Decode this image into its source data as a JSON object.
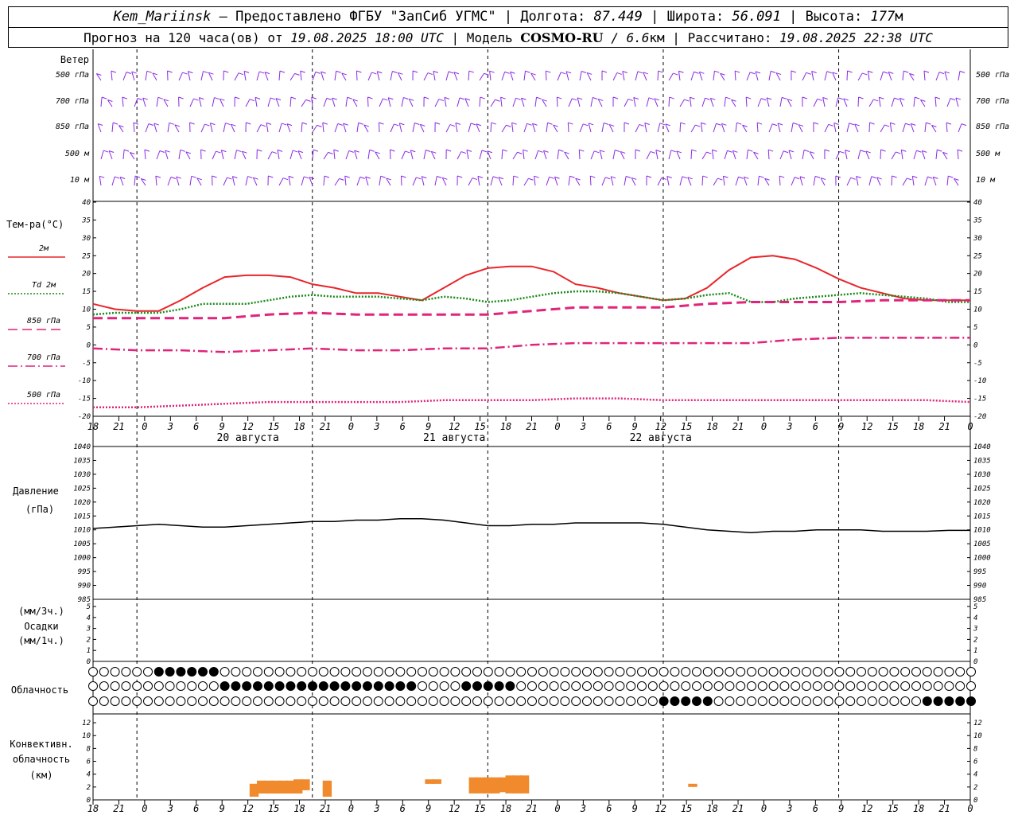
{
  "header": {
    "station": "Kem_Mariinsk",
    "provider": " – Предоставлено ФГБУ \"ЗапСиб УГМС\" | ",
    "lon_label": "Долгота: ",
    "lon": "87.449",
    "lat_label": " | Широта: ",
    "lat": "56.091",
    "alt_label": " | Высота: ",
    "alt": "177",
    "alt_unit": "м",
    "forecast_label": "Прогноз на 120 часа(ов) от ",
    "forecast_start": "19.08.2025 18:00 UTC",
    "model_label": "  | Модель ",
    "model_name": "COSMO-RU",
    "model_res_sep": " / ",
    "model_res": "6.6",
    "model_res_unit": "км",
    "computed_label": " | Рассчитано: ",
    "computed": "19.08.2025 22:38 UTC"
  },
  "time_axis": {
    "hour_labels": [
      "18",
      "21",
      "0",
      "3",
      "6",
      "9",
      "12",
      "15",
      "18",
      "21",
      "0",
      "3",
      "6",
      "9",
      "12",
      "15",
      "18",
      "21",
      "0",
      "3",
      "6",
      "9",
      "12",
      "15",
      "18",
      "21",
      "0",
      "3",
      "6",
      "9",
      "12",
      "15",
      "18",
      "21",
      "0"
    ],
    "date_labels": [
      "20 августа",
      "21 августа",
      "22 августа"
    ]
  },
  "wind_panel": {
    "title": "Ветер",
    "levels": [
      "500 гПа",
      "700 гПа",
      "850 гПа",
      "500 м",
      "10  м"
    ],
    "levels_right": [
      "500 гПа",
      "700 гПа",
      "850 гПа",
      "500 м",
      "10  м"
    ],
    "color": "#8a2be2"
  },
  "temp_panel": {
    "title": "Тем-ра(°С)",
    "legend": [
      {
        "name": "2м",
        "color": "#e8262b",
        "style": "solid"
      },
      {
        "name": "Td  2м",
        "color": "#1a8a1a",
        "style": "dot"
      },
      {
        "name": "850 гПа",
        "color": "#e0247a",
        "style": "dash"
      },
      {
        "name": "700 гПа",
        "color": "#e0247a",
        "style": "dashdot"
      },
      {
        "name": "500 гПа",
        "color": "#e0247a",
        "style": "dot"
      }
    ],
    "yticks": [
      "40",
      "35",
      "30",
      "25",
      "20",
      "15",
      "10",
      "5",
      "0",
      "-5",
      "-10",
      "-15",
      "-20"
    ]
  },
  "pressure_panel": {
    "title1": "Давление",
    "title2": "(гПа)",
    "yticks": [
      "1040",
      "1035",
      "1030",
      "1025",
      "1020",
      "1015",
      "1010",
      "1005",
      "1000",
      "995",
      "990",
      "985"
    ]
  },
  "precip_panel": {
    "title1": "(мм/3ч.)",
    "title2": "Осадки",
    "title3": "(мм/1ч.)",
    "yticks": [
      "5",
      "4",
      "3",
      "2",
      "1",
      "0"
    ]
  },
  "cloud_panel": {
    "title": "Облачность"
  },
  "conv_panel": {
    "title1": "Конвективн.",
    "title2": "облачность",
    "title3": "(км)",
    "yticks": [
      "12",
      "10",
      "8",
      "6",
      "4",
      "2",
      "0"
    ],
    "color": "#f08a2c"
  },
  "chart_data": [
    {
      "type": "line",
      "title": "Тем-ра(°С)",
      "x_unit": "hours from 19.08.2025 18:00 UTC",
      "ylim": [
        -20,
        40
      ],
      "series": [
        {
          "name": "2м",
          "x": [
            0,
            3,
            6,
            9,
            12,
            15,
            18,
            21,
            24,
            27,
            30,
            33,
            36,
            39,
            42,
            45,
            48,
            51,
            54,
            57,
            60,
            63,
            66,
            69,
            72,
            75,
            78,
            81,
            84,
            87,
            90,
            93,
            96,
            99,
            102,
            105,
            108,
            111,
            114,
            117,
            120
          ],
          "values": [
            11.5,
            10,
            9.5,
            9.5,
            12.5,
            16,
            19,
            19.5,
            19.5,
            19,
            17,
            16,
            14.5,
            14.5,
            13.5,
            12.5,
            16,
            19.5,
            21.5,
            22,
            22,
            20.5,
            17,
            16,
            14.5,
            13.5,
            12.5,
            13,
            16,
            21,
            24.5,
            25,
            24,
            21.5,
            18.5,
            16,
            14.5,
            13,
            12.5,
            12.5,
            12.5
          ]
        },
        {
          "name": "Td  2м",
          "x": [
            0,
            3,
            6,
            9,
            12,
            15,
            18,
            21,
            24,
            27,
            30,
            33,
            36,
            39,
            42,
            45,
            48,
            51,
            54,
            57,
            60,
            63,
            66,
            69,
            72,
            75,
            78,
            81,
            84,
            87,
            90,
            93,
            96,
            99,
            102,
            105,
            108,
            111,
            114,
            117,
            120
          ],
          "values": [
            8.5,
            9,
            9,
            9,
            10,
            11.5,
            11.5,
            11.5,
            12.5,
            13.5,
            14,
            13.5,
            13.5,
            13.5,
            13,
            12.5,
            13.5,
            13,
            12,
            12.5,
            13.5,
            14.5,
            15,
            15,
            14.5,
            13.5,
            12.5,
            13,
            14,
            14.5,
            12,
            12,
            13,
            13.5,
            14,
            14.5,
            14,
            13.5,
            13,
            12,
            12
          ]
        },
        {
          "name": "850 гПа",
          "x": [
            0,
            6,
            12,
            18,
            24,
            30,
            36,
            42,
            48,
            54,
            60,
            66,
            72,
            78,
            84,
            90,
            96,
            102,
            108,
            114,
            120
          ],
          "values": [
            7.5,
            7.5,
            7.5,
            7.5,
            8.5,
            9,
            8.5,
            8.5,
            8.5,
            8.5,
            9.5,
            10.5,
            10.5,
            10.5,
            11.5,
            12,
            12,
            12,
            12.5,
            12.5,
            12.5
          ]
        },
        {
          "name": "700 гПа",
          "x": [
            0,
            6,
            12,
            18,
            24,
            30,
            36,
            42,
            48,
            54,
            60,
            66,
            72,
            78,
            84,
            90,
            96,
            102,
            108,
            114,
            120
          ],
          "values": [
            -1,
            -1.5,
            -1.5,
            -2,
            -1.5,
            -1,
            -1.5,
            -1.5,
            -1,
            -1,
            0,
            0.5,
            0.5,
            0.5,
            0.5,
            0.5,
            1.5,
            2,
            2,
            2,
            2
          ]
        },
        {
          "name": "500 гПа",
          "x": [
            0,
            6,
            12,
            18,
            24,
            30,
            36,
            42,
            48,
            54,
            60,
            66,
            72,
            78,
            84,
            90,
            96,
            102,
            108,
            114,
            120
          ],
          "values": [
            -17.5,
            -17.5,
            -17,
            -16.5,
            -16,
            -16,
            -16,
            -16,
            -15.5,
            -15.5,
            -15.5,
            -15,
            -15,
            -15.5,
            -15.5,
            -15.5,
            -15.5,
            -15.5,
            -15.5,
            -15.5,
            -16
          ]
        }
      ]
    },
    {
      "type": "line",
      "title": "Давление (гПа)",
      "x_unit": "hours from 19.08.2025 18:00 UTC",
      "ylim": [
        985,
        1040
      ],
      "series": [
        {
          "name": "",
          "x": [
            0,
            3,
            6,
            9,
            12,
            15,
            18,
            21,
            24,
            27,
            30,
            33,
            36,
            39,
            42,
            45,
            48,
            51,
            54,
            57,
            60,
            63,
            66,
            69,
            72,
            75,
            78,
            81,
            84,
            87,
            90,
            93,
            96,
            99,
            102,
            105,
            108,
            111,
            114,
            117,
            120
          ],
          "values": [
            1010.5,
            1011,
            1011.5,
            1012,
            1011.5,
            1011,
            1011,
            1011.5,
            1012,
            1012.5,
            1013,
            1013,
            1013.5,
            1013.5,
            1014,
            1014,
            1013.5,
            1012.5,
            1011.5,
            1011.5,
            1012,
            1012,
            1012.5,
            1012.5,
            1012.5,
            1012.5,
            1012,
            1011,
            1010,
            1009.5,
            1009,
            1009.5,
            1009.5,
            1010,
            1010,
            1010,
            1009.5,
            1009.5,
            1009.5,
            1009.8,
            1009.8
          ]
        }
      ]
    },
    {
      "type": "bar",
      "title": "Конвективн. облачность (км)",
      "x_unit": "hours from 19.08.2025 18:00 UTC",
      "ylim": [
        0,
        13
      ],
      "bars": [
        {
          "x": 22,
          "base": 0.5,
          "top": 2.5
        },
        {
          "x": 23,
          "base": 1,
          "top": 3
        },
        {
          "x": 24,
          "base": 1,
          "top": 3
        },
        {
          "x": 25,
          "base": 1,
          "top": 3
        },
        {
          "x": 26,
          "base": 1,
          "top": 3
        },
        {
          "x": 27,
          "base": 1,
          "top": 3
        },
        {
          "x": 28,
          "base": 1,
          "top": 3.2
        },
        {
          "x": 29,
          "base": 1.5,
          "top": 3.2
        },
        {
          "x": 32,
          "base": 0.5,
          "top": 3
        },
        {
          "x": 46,
          "base": 2.5,
          "top": 3.2
        },
        {
          "x": 47,
          "base": 2.5,
          "top": 3.2
        },
        {
          "x": 52,
          "base": 1,
          "top": 3.5
        },
        {
          "x": 53,
          "base": 1,
          "top": 3.5
        },
        {
          "x": 54,
          "base": 1,
          "top": 3.5
        },
        {
          "x": 55,
          "base": 1,
          "top": 3.5
        },
        {
          "x": 56,
          "base": 1.2,
          "top": 3.5
        },
        {
          "x": 57,
          "base": 1,
          "top": 3.8
        },
        {
          "x": 58,
          "base": 1,
          "top": 3.8
        },
        {
          "x": 59,
          "base": 1,
          "top": 3.8
        },
        {
          "x": 82,
          "base": 2,
          "top": 2.5
        }
      ]
    }
  ]
}
